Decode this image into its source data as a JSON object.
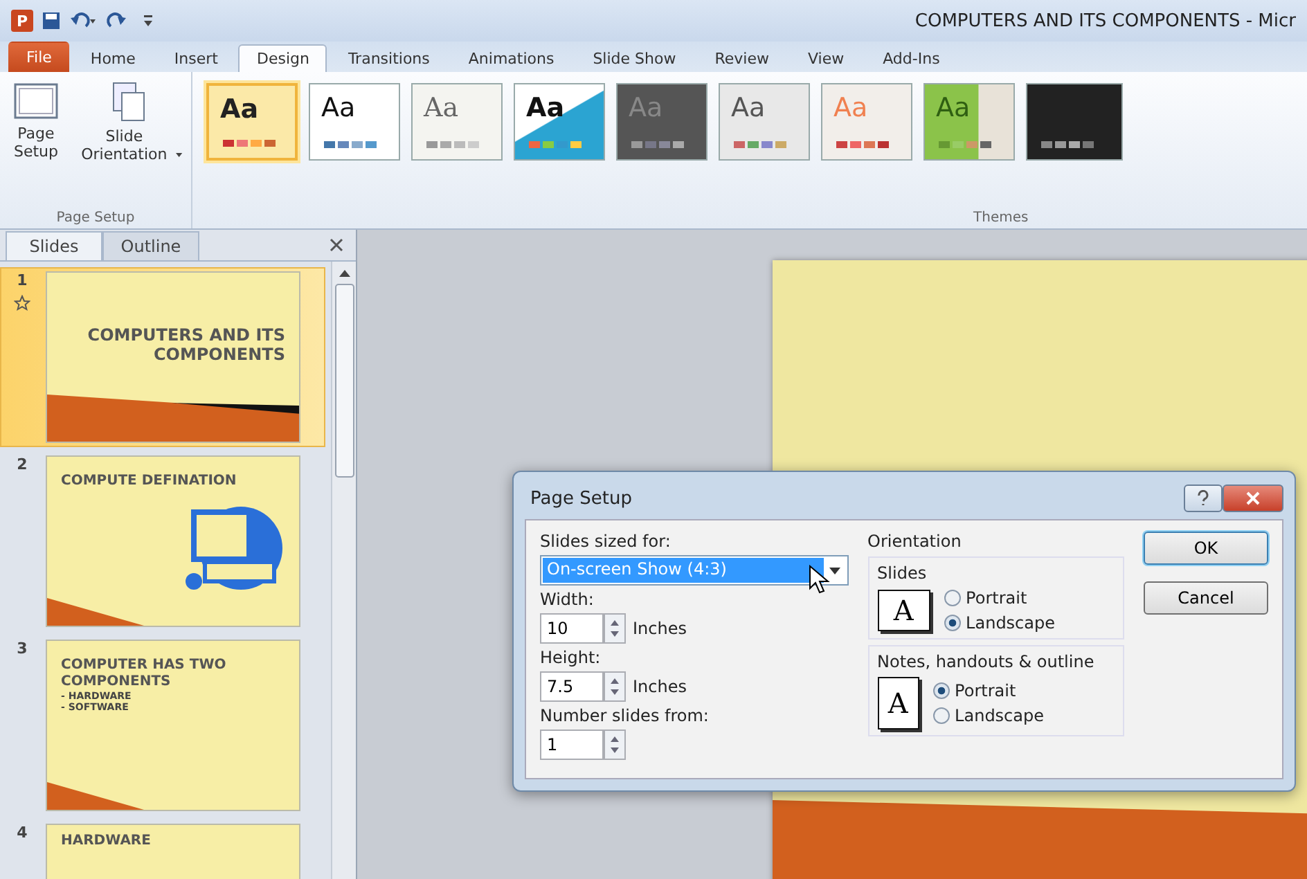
{
  "window": {
    "app_letter": "P",
    "title": "COMPUTERS AND ITS COMPONENTS - Micr"
  },
  "ribbon_tabs": [
    {
      "label": "File",
      "kind": "file",
      "selected": false
    },
    {
      "label": "Home",
      "kind": "tab",
      "selected": false
    },
    {
      "label": "Insert",
      "kind": "tab",
      "selected": false
    },
    {
      "label": "Design",
      "kind": "tab",
      "selected": true
    },
    {
      "label": "Transitions",
      "kind": "tab",
      "selected": false
    },
    {
      "label": "Animations",
      "kind": "tab",
      "selected": false
    },
    {
      "label": "Slide Show",
      "kind": "tab",
      "selected": false
    },
    {
      "label": "Review",
      "kind": "tab",
      "selected": false
    },
    {
      "label": "View",
      "kind": "tab",
      "selected": false
    },
    {
      "label": "Add-Ins",
      "kind": "tab",
      "selected": false
    }
  ],
  "page_setup_group": {
    "label": "Page Setup",
    "buttons": [
      {
        "label": "Page Setup",
        "kind": "page",
        "dropdown": false
      },
      {
        "label": "Slide Orientation",
        "kind": "orientation",
        "dropdown": true
      }
    ]
  },
  "themes_group": {
    "label": "Themes",
    "themes": [
      {
        "label": "Aa",
        "kind": "office",
        "selected": true
      },
      {
        "label": "Aa",
        "kind": "plain",
        "selected": false
      },
      {
        "label": "Aa",
        "kind": "serif",
        "selected": false
      },
      {
        "label": "Aa",
        "kind": "diagonal",
        "selected": false
      },
      {
        "label": "Aa",
        "kind": "dark",
        "selected": false
      },
      {
        "label": "Aa",
        "kind": "stripe",
        "selected": false
      },
      {
        "label": "Aa",
        "kind": "orange",
        "selected": false
      },
      {
        "label": "Aa",
        "kind": "green",
        "selected": false
      },
      {
        "kind": "black",
        "selected": false
      }
    ]
  },
  "slides_pane": {
    "tabs": [
      {
        "label": "Slides",
        "selected": true
      },
      {
        "label": "Outline",
        "selected": false
      }
    ],
    "slides": [
      {
        "number": "1",
        "selected": true,
        "animated": true,
        "kind": "title",
        "title": "COMPUTERS AND ITS COMPONENTS"
      },
      {
        "number": "2",
        "selected": false,
        "animated": false,
        "kind": "picture",
        "title": "COMPUTE DEFINATION"
      },
      {
        "number": "3",
        "selected": false,
        "animated": false,
        "kind": "bullets",
        "title": "COMPUTER HAS TWO COMPONENTS",
        "bullets": [
          "- HARDWARE",
          "- SOFTWARE"
        ]
      },
      {
        "number": "4",
        "selected": false,
        "animated": false,
        "kind": "heading",
        "title": "HARDWARE"
      }
    ]
  },
  "dialog": {
    "title": "Page Setup",
    "size_label": "Slides sized for:",
    "size_value": "On-screen Show (4:3)",
    "fields": [
      {
        "label": "Width:",
        "value": "10",
        "unit": "Inches"
      },
      {
        "label": "Height:",
        "value": "7.5",
        "unit": "Inches"
      },
      {
        "label": "Number slides from:",
        "value": "1"
      }
    ],
    "orientation_label": "Orientation",
    "orientation_groups": [
      {
        "label": "Slides",
        "icon_letter": "A",
        "kind": "landscape",
        "options": [
          {
            "label": "Portrait",
            "selected": false
          },
          {
            "label": "Landscape",
            "selected": true
          }
        ]
      },
      {
        "label": "Notes, handouts & outline",
        "icon_letter": "A",
        "kind": "portrait",
        "options": [
          {
            "label": "Portrait",
            "selected": true
          },
          {
            "label": "Landscape",
            "selected": false
          }
        ]
      }
    ],
    "buttons": [
      {
        "label": "OK",
        "default": true
      },
      {
        "label": "Cancel",
        "default": false
      }
    ]
  }
}
